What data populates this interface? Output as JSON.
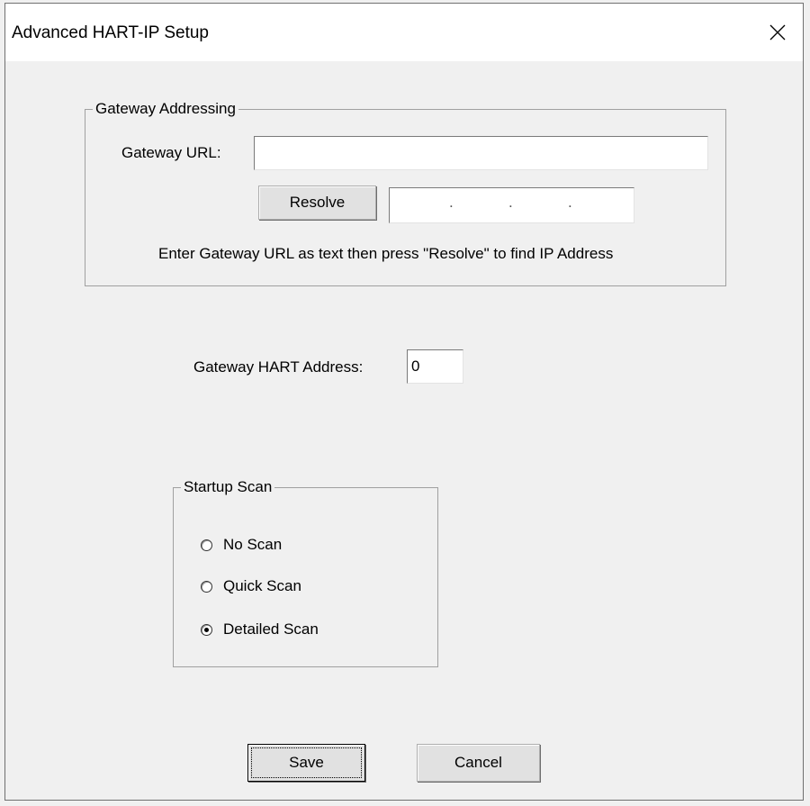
{
  "window": {
    "title": "Advanced HART-IP Setup"
  },
  "gateway_addressing": {
    "group_label": "Gateway Addressing",
    "url_label": "Gateway URL:",
    "url_value": "",
    "resolve_label": "Resolve",
    "ip_value": "",
    "hint": "Enter Gateway URL as text then press \"Resolve\" to find IP Address"
  },
  "hart_address": {
    "label": "Gateway HART Address:",
    "value": "0"
  },
  "startup_scan": {
    "group_label": "Startup Scan",
    "options": [
      {
        "label": "No Scan",
        "checked": false
      },
      {
        "label": "Quick Scan",
        "checked": false
      },
      {
        "label": "Detailed Scan",
        "checked": true
      }
    ]
  },
  "footer": {
    "save_label": "Save",
    "cancel_label": "Cancel"
  }
}
